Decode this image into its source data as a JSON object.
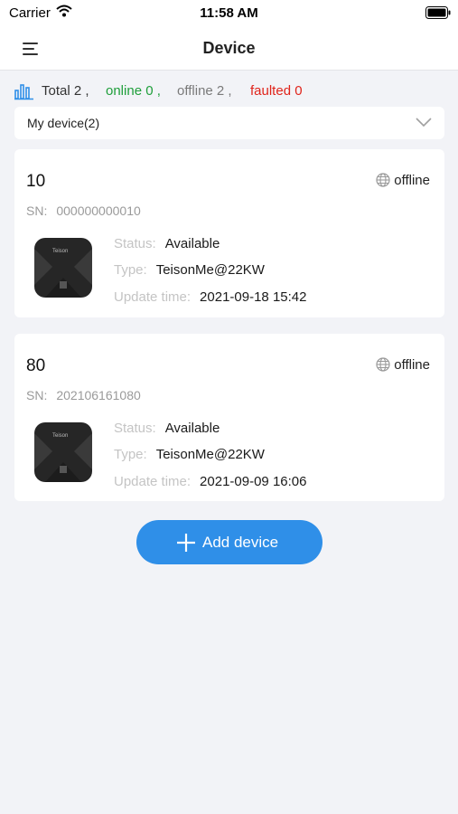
{
  "status_bar": {
    "carrier": "Carrier",
    "time": "11:58 AM"
  },
  "nav": {
    "title": "Device",
    "menu_icon": "hamburger-menu-icon"
  },
  "summary": {
    "icon": "bar-chart-icon",
    "total": "Total 2 ,",
    "online": "online 0 ,",
    "offline": "offline 2 ,",
    "faulted": "faulted 0",
    "colors": {
      "online": "#1e9e3a",
      "offline": "#7a7a7a",
      "faulted": "#e0241b"
    }
  },
  "filter": {
    "selected": "My device(2)",
    "icon": "chevron-down-icon"
  },
  "devices": [
    {
      "name": "10",
      "connection": "offline",
      "sn_label": "SN:",
      "sn": "000000000010",
      "status_label": "Status:",
      "status": "Available",
      "type_label": "Type:",
      "type": "TeisonMe@22KW",
      "update_label": "Update time:",
      "update_time": "2021-09-18 15:42"
    },
    {
      "name": "80",
      "connection": "offline",
      "sn_label": "SN:",
      "sn": "202106161080",
      "status_label": "Status:",
      "status": "Available",
      "type_label": "Type:",
      "type": "TeisonMe@22KW",
      "update_label": "Update time:",
      "update_time": "2021-09-09 16:06"
    }
  ],
  "add_button": {
    "label": "Add device",
    "icon": "plus-icon",
    "color": "#2f8fe8"
  }
}
